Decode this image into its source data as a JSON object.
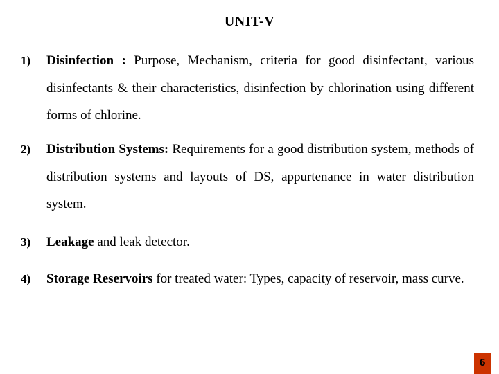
{
  "slide": {
    "title": "UNIT-V",
    "items": [
      {
        "number": "1)",
        "heading": "Disinfection :",
        "text": " Purpose, Mechanism, criteria for good disinfectant, various disinfectants & their characteristics, disinfection by chlorination using different forms of chlorine."
      },
      {
        "number": "2)",
        "heading": "Distribution Systems:",
        "text": " Requirements for a good distribution system, methods of distribution systems and layouts of DS, appurtenance in water distribution system."
      },
      {
        "number": "3)",
        "heading": "Leakage",
        "text": " and leak detector."
      },
      {
        "number": "4)",
        "heading": "Storage Reservoirs",
        "text": " for treated water: Types, capacity of reservoir, mass curve."
      }
    ],
    "page_number": "6",
    "colors": {
      "page_badge": "#cc3300"
    }
  }
}
